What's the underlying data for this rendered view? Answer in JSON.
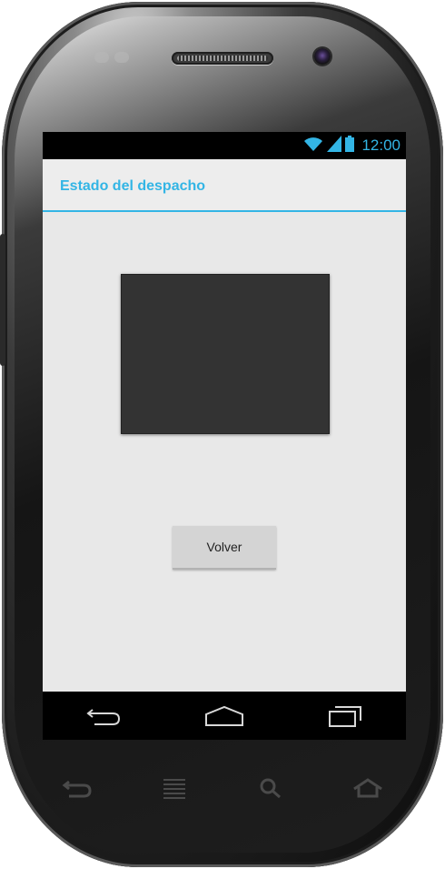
{
  "status_bar": {
    "time": "12:00",
    "icons": [
      "wifi-icon",
      "signal-icon",
      "battery-icon"
    ],
    "accent": "#33b5e5"
  },
  "action_bar": {
    "title": "Estado del despacho",
    "accent": "#33b5e5"
  },
  "content": {
    "box_color": "#333333",
    "button_label": "Volver"
  },
  "nav_bar": {
    "buttons": [
      "back-icon",
      "home-icon",
      "recent-apps-icon"
    ]
  },
  "hardware_keys": [
    "back-icon",
    "menu-icon",
    "search-icon",
    "home-icon"
  ]
}
